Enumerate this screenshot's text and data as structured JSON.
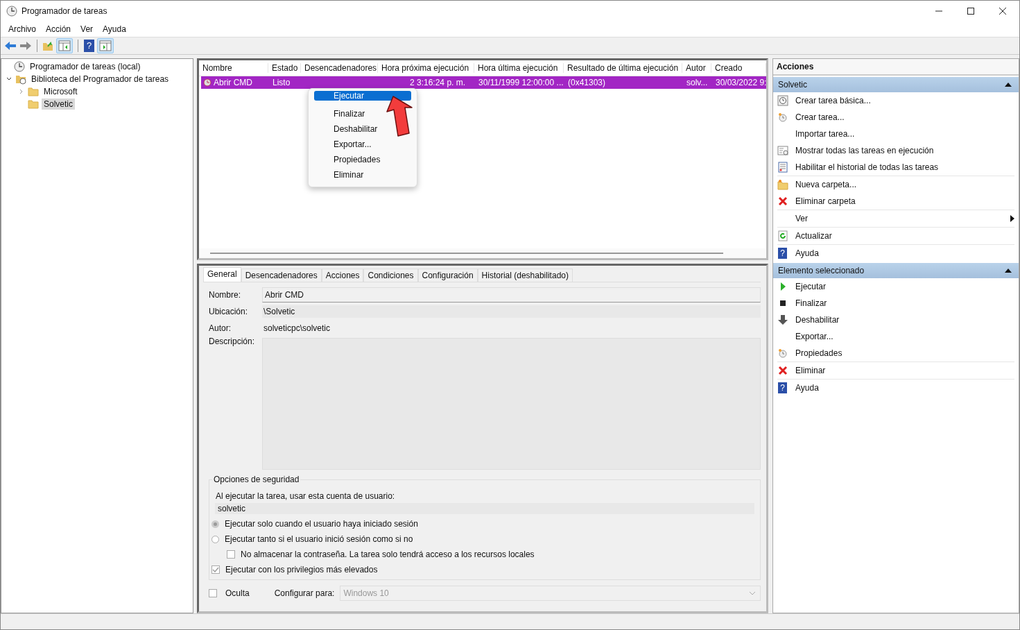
{
  "window": {
    "title": "Programador de tareas"
  },
  "menu": [
    "Archivo",
    "Acción",
    "Ver",
    "Ayuda"
  ],
  "toolbar": {
    "help_glyph": "?"
  },
  "tree": [
    {
      "label": "Programador de tareas (local)",
      "selected": false,
      "children": [
        {
          "label": "Biblioteca del Programador de tareas",
          "selected": false,
          "expanded": true,
          "children": [
            {
              "label": "Microsoft",
              "selected": false,
              "expanded": false
            },
            {
              "label": "Solvetic",
              "selected": true
            }
          ]
        }
      ]
    }
  ],
  "table": {
    "columns": [
      "Nombre",
      "Estado",
      "Desencadenadores",
      "Hora próxima ejecución",
      "Hora última ejecución",
      "Resultado de última ejecución",
      "Autor",
      "Creado"
    ],
    "rows": [
      {
        "selected": true,
        "cells": [
          "Abrir CMD",
          "Listo",
          "",
          "2 3:16:24 p. m.",
          "30/11/1999 12:00:00 ...",
          "(0x41303)",
          "solv...",
          "30/03/2022 9:"
        ]
      }
    ]
  },
  "context_menu": [
    {
      "label": "Ejecutar",
      "selected": true
    },
    {
      "label": "Finalizar",
      "selected": false
    },
    {
      "label": "Deshabilitar",
      "selected": false
    },
    {
      "label": "Exportar...",
      "selected": false
    },
    {
      "label": "Propiedades",
      "selected": false
    },
    {
      "label": "Eliminar",
      "selected": false
    }
  ],
  "details": {
    "tabs": [
      {
        "label": "General",
        "selected": true
      },
      {
        "label": "Desencadenadores",
        "selected": false
      },
      {
        "label": "Acciones",
        "selected": false
      },
      {
        "label": "Condiciones",
        "selected": false
      },
      {
        "label": "Configuración",
        "selected": false
      },
      {
        "label": "Historial (deshabilitado)",
        "selected": false
      }
    ],
    "name_label": "Nombre:",
    "name_value": "Abrir CMD",
    "location_label": "Ubicación:",
    "location_value": "\\Solvetic",
    "author_label": "Autor:",
    "author_value": "solveticpc\\solvetic",
    "description_label": "Descripción:",
    "security": {
      "title": "Opciones de seguridad",
      "account_label": "Al ejecutar la tarea, usar esta cuenta de usuario:",
      "account_value": "solvetic",
      "options": [
        {
          "kind": "radio",
          "label": "Ejecutar solo cuando el usuario haya iniciado sesión",
          "selected": true
        },
        {
          "kind": "radio",
          "label": "Ejecutar tanto si el usuario inició sesión como si no",
          "selected": false
        },
        {
          "kind": "checkbox",
          "label": "No almacenar la contraseña. La tarea solo tendrá acceso a los recursos locales",
          "checked": false,
          "indented": true
        },
        {
          "kind": "checkbox",
          "label": "Ejecutar con los privilegios más elevados",
          "checked": true,
          "indented": false
        }
      ]
    },
    "hidden": {
      "label": "Oculta",
      "checked": false
    },
    "configure_label": "Configurar para:",
    "configure_value": "Windows 10"
  },
  "actions": {
    "title": "Acciones",
    "sections": [
      {
        "title": "Solvetic",
        "items": [
          {
            "label": "Crear tarea básica...",
            "kind": "clockdoc",
            "divider": false,
            "submenu": false
          },
          {
            "label": "Crear tarea...",
            "kind": "clock",
            "divider": false,
            "submenu": false
          },
          {
            "label": "Importar tarea...",
            "kind": "none",
            "divider": false,
            "submenu": false
          },
          {
            "label": "Mostrar todas las tareas en ejecución",
            "kind": "list",
            "divider": false,
            "submenu": false
          },
          {
            "label": "Habilitar el historial de todas las tareas",
            "kind": "history",
            "divider": true,
            "submenu": false
          },
          {
            "label": "Nueva carpeta...",
            "kind": "folder",
            "divider": false,
            "submenu": false
          },
          {
            "label": "Eliminar carpeta",
            "kind": "delete",
            "divider": true,
            "submenu": false
          },
          {
            "label": "Ver",
            "kind": "none",
            "divider": true,
            "submenu": true
          },
          {
            "label": "Actualizar",
            "kind": "refresh",
            "divider": true,
            "submenu": false
          },
          {
            "label": "Ayuda",
            "kind": "help",
            "glyph": "?",
            "divider": false,
            "submenu": false
          }
        ]
      },
      {
        "title": "Elemento seleccionado",
        "items": [
          {
            "label": "Ejecutar",
            "kind": "play",
            "divider": false,
            "submenu": false
          },
          {
            "label": "Finalizar",
            "kind": "stop",
            "divider": false,
            "submenu": false
          },
          {
            "label": "Deshabilitar",
            "kind": "down",
            "divider": false,
            "submenu": false
          },
          {
            "label": "Exportar...",
            "kind": "none",
            "divider": false,
            "submenu": false
          },
          {
            "label": "Propiedades",
            "kind": "clock",
            "divider": true,
            "submenu": false
          },
          {
            "label": "Eliminar",
            "kind": "delete",
            "divider": true,
            "submenu": false
          },
          {
            "label": "Ayuda",
            "kind": "help",
            "glyph": "?",
            "divider": false,
            "submenu": false
          }
        ]
      }
    ]
  }
}
